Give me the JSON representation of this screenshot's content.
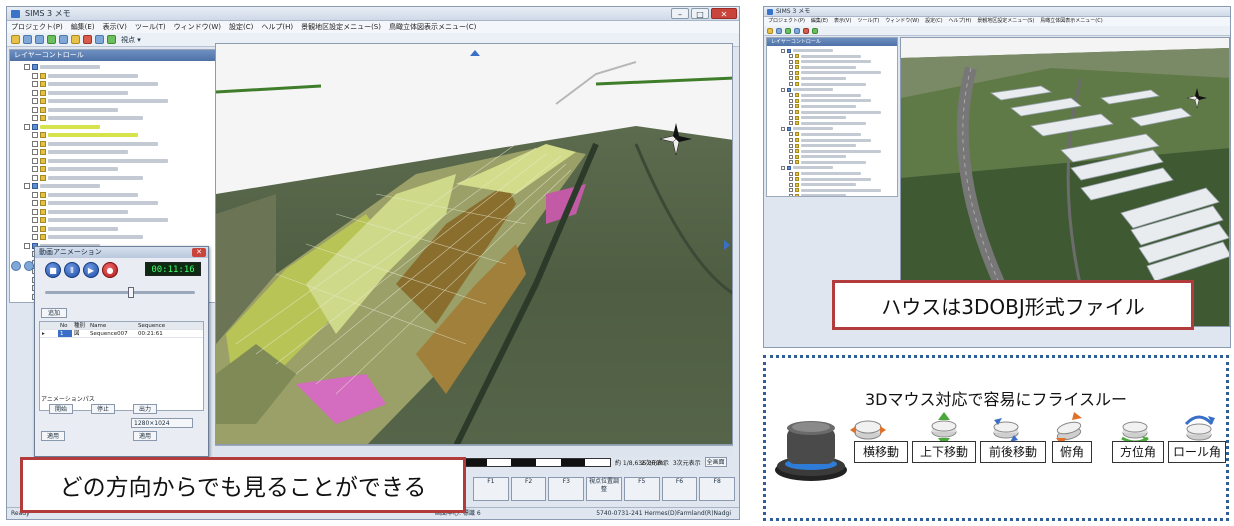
{
  "main_window": {
    "title": "SIMS 3 メモ",
    "menu": [
      "プロジェクト(P)",
      "編集(E)",
      "表示(V)",
      "ツール(T)",
      "ウィンドウ(W)",
      "設定(C)",
      "ヘルプ(H)",
      "景観地区設定メニュー(S)",
      "鳥瞰立体図表示メニュー(C)"
    ],
    "toolbar_label": "視点 ▾",
    "layer_panel_title": "レイヤーコントロール",
    "status_left": "Ready",
    "status_middle": "画面中心: 標識 6",
    "status_right": "5740-0731-241 Hermes(D)Farmland(R)Nadgi"
  },
  "anim_dialog": {
    "title": "動画アニメーション",
    "timer": "00:11:16",
    "add_button": "追加",
    "columns": [
      "No",
      "種別",
      "Name",
      "Sequence"
    ],
    "rows": [
      [
        "1",
        "図",
        "Sequence007",
        "00:21:61"
      ]
    ],
    "section_label": "アニメーションパス",
    "buttons": [
      "開始",
      "停止",
      "出力"
    ],
    "select_value": "1280×1024",
    "apply_button": "適用",
    "close_button": "適用"
  },
  "view_status": {
    "scale_text": "約 1/8,636  300m",
    "radio_options": [
      "2次元表示",
      "3次元表示"
    ],
    "fullscreen_button": "全画面",
    "fkeys": [
      "F1",
      "F2",
      "F3",
      "F4",
      "F5",
      "F6",
      "F7",
      "F8"
    ],
    "special_key": "視点位置調整"
  },
  "callout_left": "どの方向からでも見ることができる",
  "callout_right": "ハウスは3DOBJ形式ファイル",
  "mouse_panel": {
    "title": "3Dマウス対応で容易にフライスルー",
    "ops": [
      "横移動",
      "上下移動",
      "前後移動",
      "俯角",
      "方位角",
      "ロール角"
    ]
  },
  "colors": {
    "callout_border": "#b23b3b",
    "dash_border": "#2f5f96",
    "title_bar": "#cfd9e7"
  },
  "icons": [
    "app-icon",
    "play-icon",
    "pause-icon",
    "stop-icon",
    "record-icon",
    "compass-icon",
    "3d-mouse-icon",
    "pan-icon",
    "updown-icon",
    "forward-icon",
    "tilt-icon",
    "azimuth-icon",
    "roll-icon"
  ]
}
